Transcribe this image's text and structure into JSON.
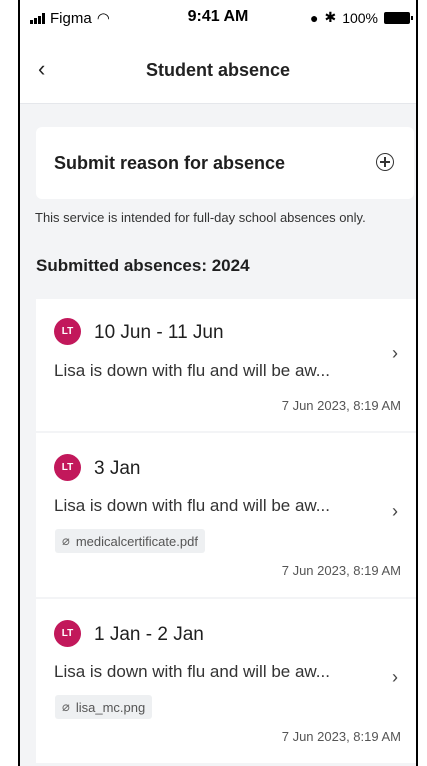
{
  "status_bar": {
    "carrier": "Figma",
    "time": "9:41 AM",
    "battery": "100%"
  },
  "nav": {
    "back_icon": "chevron-left-icon",
    "title": "Student absence"
  },
  "submit": {
    "label": "Submit reason for absence",
    "icon": "plus-circle-icon"
  },
  "notice": "This service is intended for full-day school absences only.",
  "section_heading": "Submitted absences: 2024",
  "absences": [
    {
      "avatar": "LT",
      "dates": "10 Jun - 11 Jun",
      "reason": "Lisa is down with flu and will be aw...",
      "attachment": "",
      "timestamp": "7 Jun 2023, 8:19 AM"
    },
    {
      "avatar": "LT",
      "dates": "3 Jan",
      "reason": "Lisa is down with flu and will be aw...",
      "attachment": "medicalcertificate.pdf",
      "timestamp": "7 Jun 2023, 8:19 AM"
    },
    {
      "avatar": "LT",
      "dates": "1 Jan - 2 Jan",
      "reason": "Lisa is down with flu and will be aw...",
      "attachment": "lisa_mc.png",
      "timestamp": "7 Jun 2023, 8:19 AM"
    }
  ],
  "colors": {
    "avatar": "#c2185b",
    "background": "#f3f4f6",
    "card": "#ffffff"
  }
}
